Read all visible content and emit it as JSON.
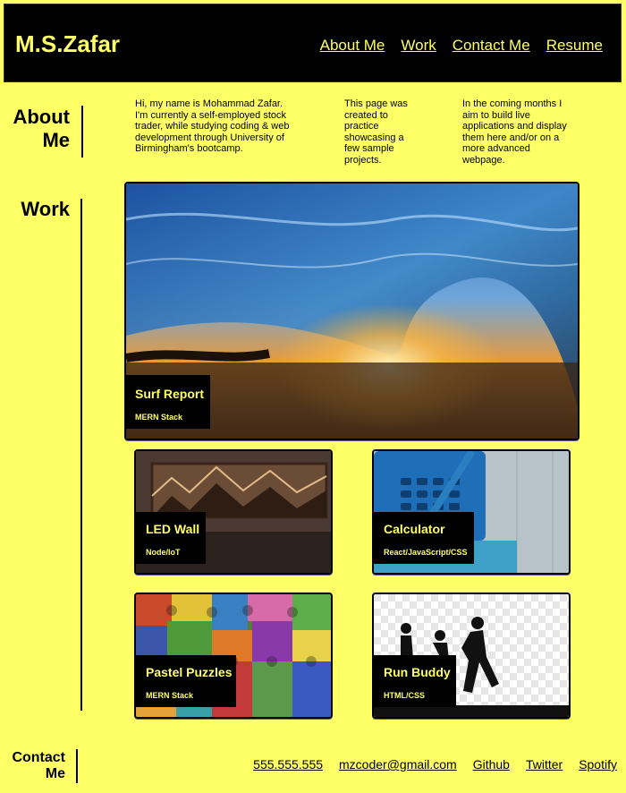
{
  "header": {
    "logo": "M.S.Zafar",
    "nav": [
      "About Me",
      "Work",
      "Contact Me",
      "Resume"
    ]
  },
  "about": {
    "title": "About Me",
    "paragraphs": [
      "Hi, my name is Mohammad Zafar. I'm currently a self-employed stock trader, while studying coding & web development through University of Birmingham's bootcamp.",
      "This page was created to practice showcasing a few sample projects.",
      "In the coming months I aim to build live applications and display them here and/or on a more advanced webpage."
    ]
  },
  "work": {
    "title": "Work",
    "projects": [
      {
        "name": "Surf Report",
        "tech": "MERN Stack"
      },
      {
        "name": "LED Wall",
        "tech": "Node/IoT"
      },
      {
        "name": "Calculator",
        "tech": "React/JavaScript/CSS"
      },
      {
        "name": "Pastel Puzzles",
        "tech": "MERN Stack"
      },
      {
        "name": "Run Buddy",
        "tech": "HTML/CSS"
      }
    ]
  },
  "contact": {
    "title": "Contact Me",
    "links": [
      "555.555.555",
      "mzcoder@gmail.com",
      "Github",
      "Twitter",
      "Spotify"
    ]
  }
}
